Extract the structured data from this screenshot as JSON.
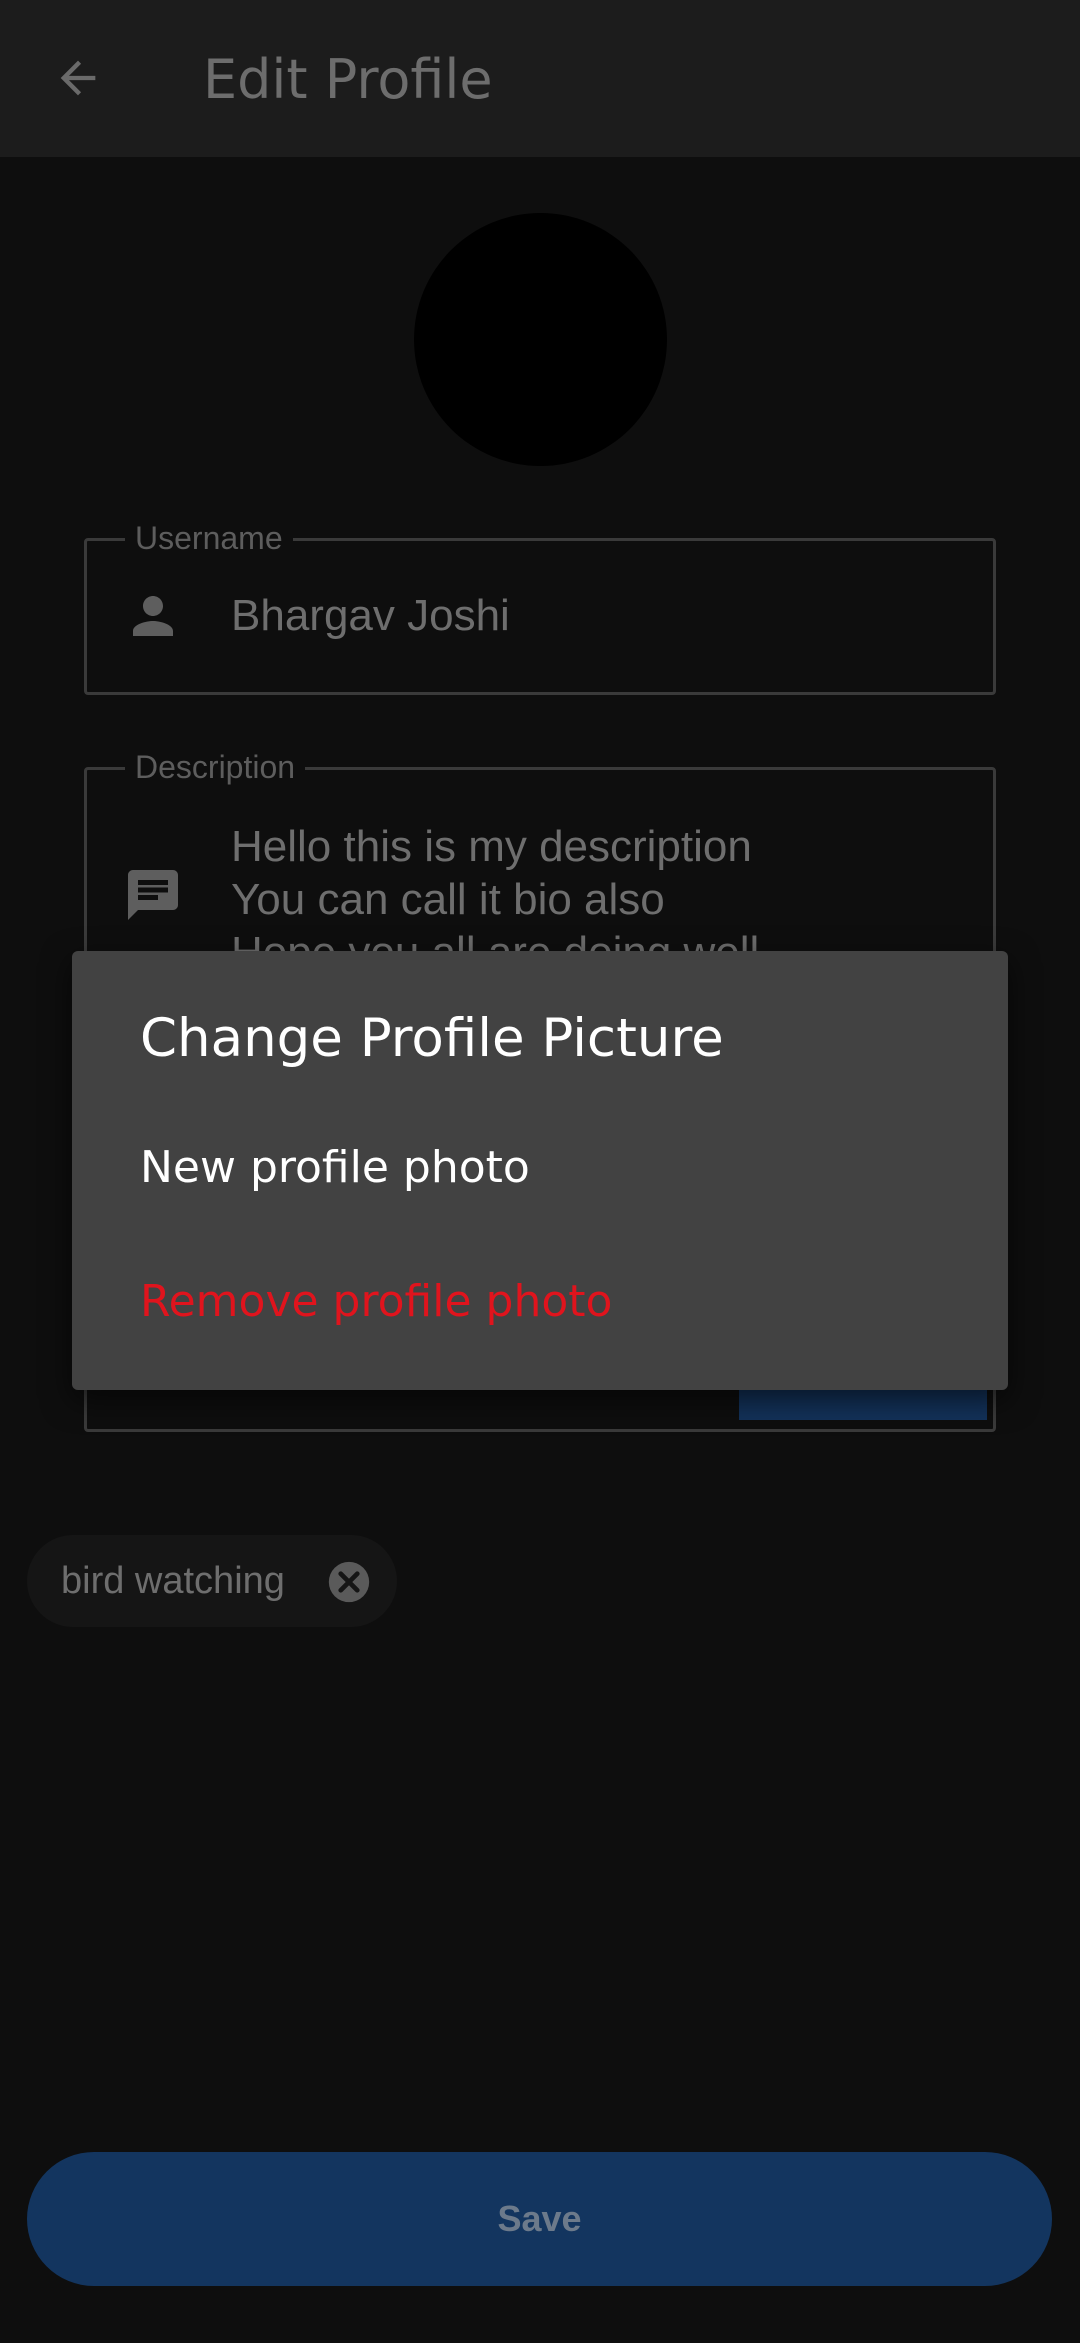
{
  "appbar": {
    "title": "Edit Profile",
    "back_icon": "arrow-back-icon"
  },
  "profile": {
    "avatar": "avatar"
  },
  "username_field": {
    "label": "Username",
    "value": "Bhargav Joshi",
    "icon": "person-icon"
  },
  "description_field": {
    "label": "Description",
    "lines": [
      "Hello this is my description",
      "You can call it bio also",
      "Hope you all are doing well"
    ],
    "icon": "message-icon"
  },
  "interests": {
    "chips": [
      {
        "label": "bird watching",
        "remove_icon": "close-circle-icon"
      }
    ]
  },
  "save_button": {
    "label": "Save"
  },
  "dialog": {
    "title": "Change Profile Picture",
    "options": [
      {
        "label": "New profile photo"
      },
      {
        "label": "Remove profile photo"
      }
    ]
  },
  "colors": {
    "background": "#0e0e0e",
    "appbar": "#1c1c1c",
    "dialog": "#424242",
    "destructive": "#e0141d",
    "primary_dimmed": "#13355f"
  }
}
